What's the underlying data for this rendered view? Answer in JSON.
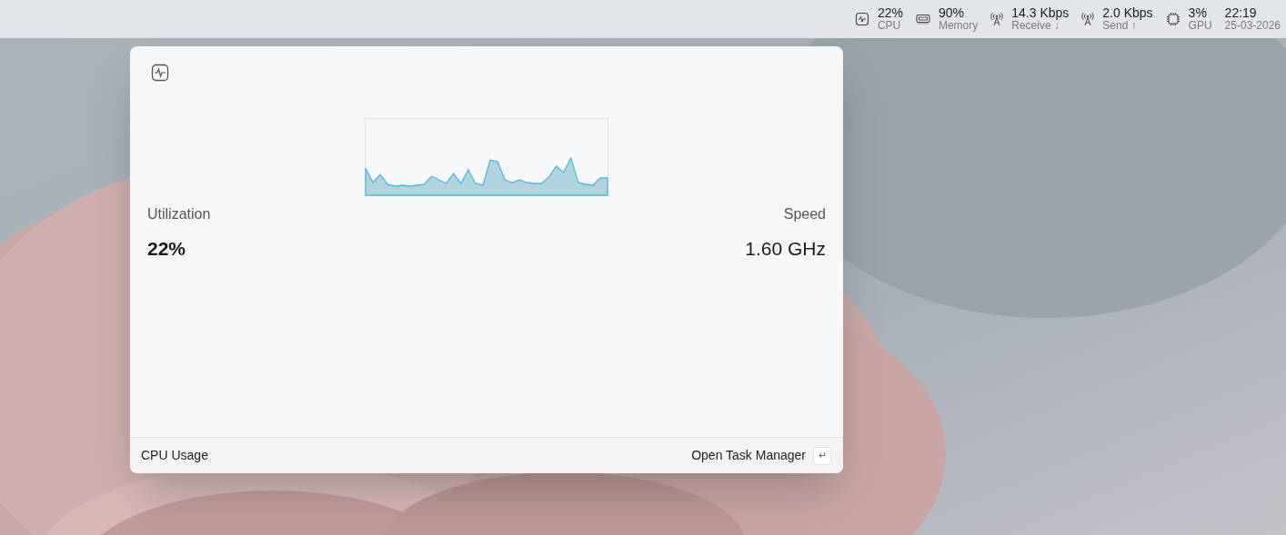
{
  "top_bar": {
    "items": [
      {
        "kind": "pulse",
        "value": "22%",
        "label": "CPU"
      },
      {
        "kind": "memory",
        "value": "90%",
        "label": "Memory"
      },
      {
        "kind": "antenna",
        "value": "14.3 Kbps",
        "label": "Receive ↓"
      },
      {
        "kind": "antenna",
        "value": "2.0 Kbps",
        "label": "Send ↑"
      },
      {
        "kind": "chip",
        "value": "3%",
        "label": "GPU"
      },
      {
        "kind": "clock",
        "value": "22:19",
        "label": "25-03-2026"
      }
    ]
  },
  "flyout": {
    "stats": [
      {
        "label": "Utilization",
        "value": "22%"
      },
      {
        "label": "Speed",
        "value": "1.60 GHz"
      }
    ],
    "footer": {
      "title": "CPU Usage",
      "action": "Open Task Manager",
      "key_glyph": "↵"
    }
  }
}
